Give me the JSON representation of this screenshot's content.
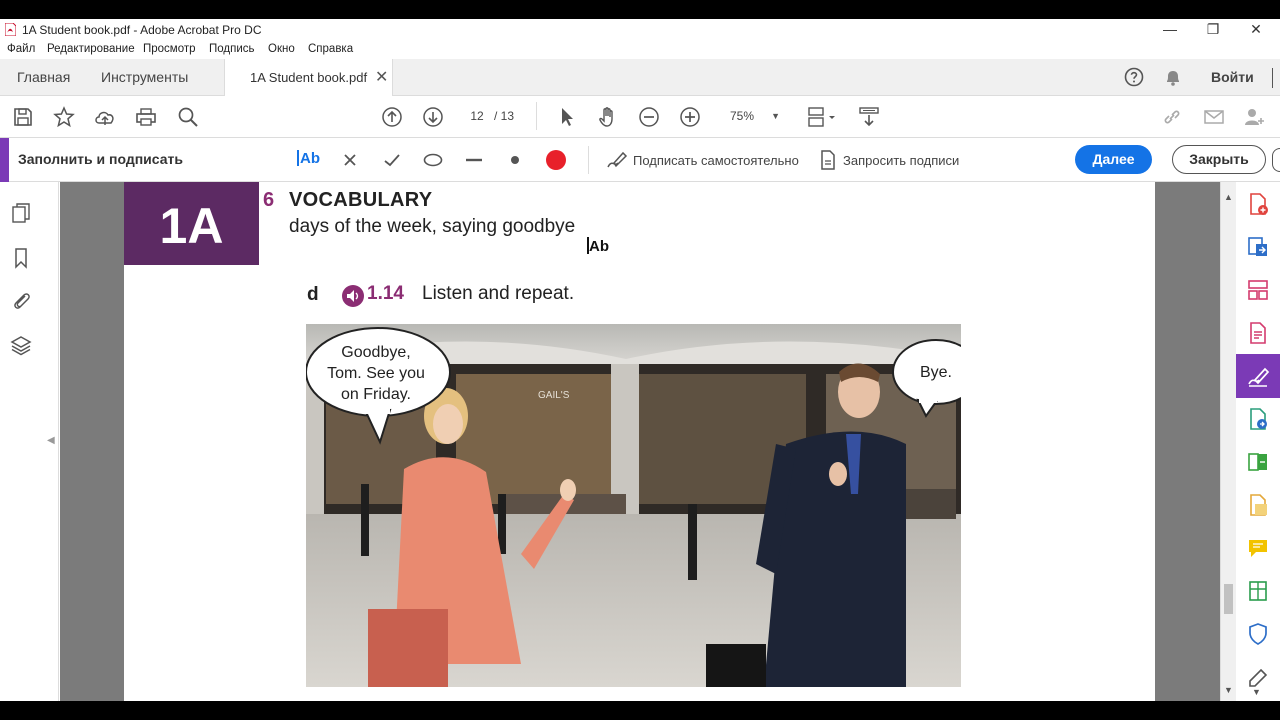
{
  "window": {
    "title": "1A Student book.pdf - Adobe Acrobat Pro DC",
    "minimize": "—",
    "maximize": "❐",
    "close": "✕"
  },
  "menu": [
    "Файл",
    "Редактирование",
    "Просмотр",
    "Подпись",
    "Окно",
    "Справка"
  ],
  "tabs": {
    "home": "Главная",
    "tools": "Инструменты",
    "document": "1A Student book.pdf",
    "close": "✕",
    "signin": "Войти"
  },
  "toolbar": {
    "page_current": "12",
    "page_total": "/ 13",
    "zoom": "75%",
    "zoom_caret": "▼"
  },
  "fill_sign": {
    "title": "Заполнить и подписать",
    "text_tool": "Ab",
    "sign_self": "Подписать самостоятельно",
    "request_sign": "Запросить подписи",
    "next_button": "Далее",
    "close_button": "Закрыть",
    "accent_color": "#7b3ab6",
    "dot_color": "#e8202a"
  },
  "page": {
    "unit": "1A",
    "section_number": "6",
    "section_title": "VOCABULARY",
    "section_subtitle": "days of the week, saying goodbye",
    "cursor_label": "Ab",
    "exercise_letter": "d",
    "audio_track": "1.14",
    "exercise_instruction": "Listen and repeat.",
    "bubble_left": [
      "Goodbye,",
      "Tom. See you",
      "on Friday."
    ],
    "bubble_right": "Bye.",
    "sign_text": "GAIL'S",
    "unit_color": "#5c2a63",
    "accent_color": "#8b2d73"
  },
  "scroll": {
    "up": "▲",
    "down": "▼"
  },
  "left_panel": {
    "collapse": "◀"
  }
}
